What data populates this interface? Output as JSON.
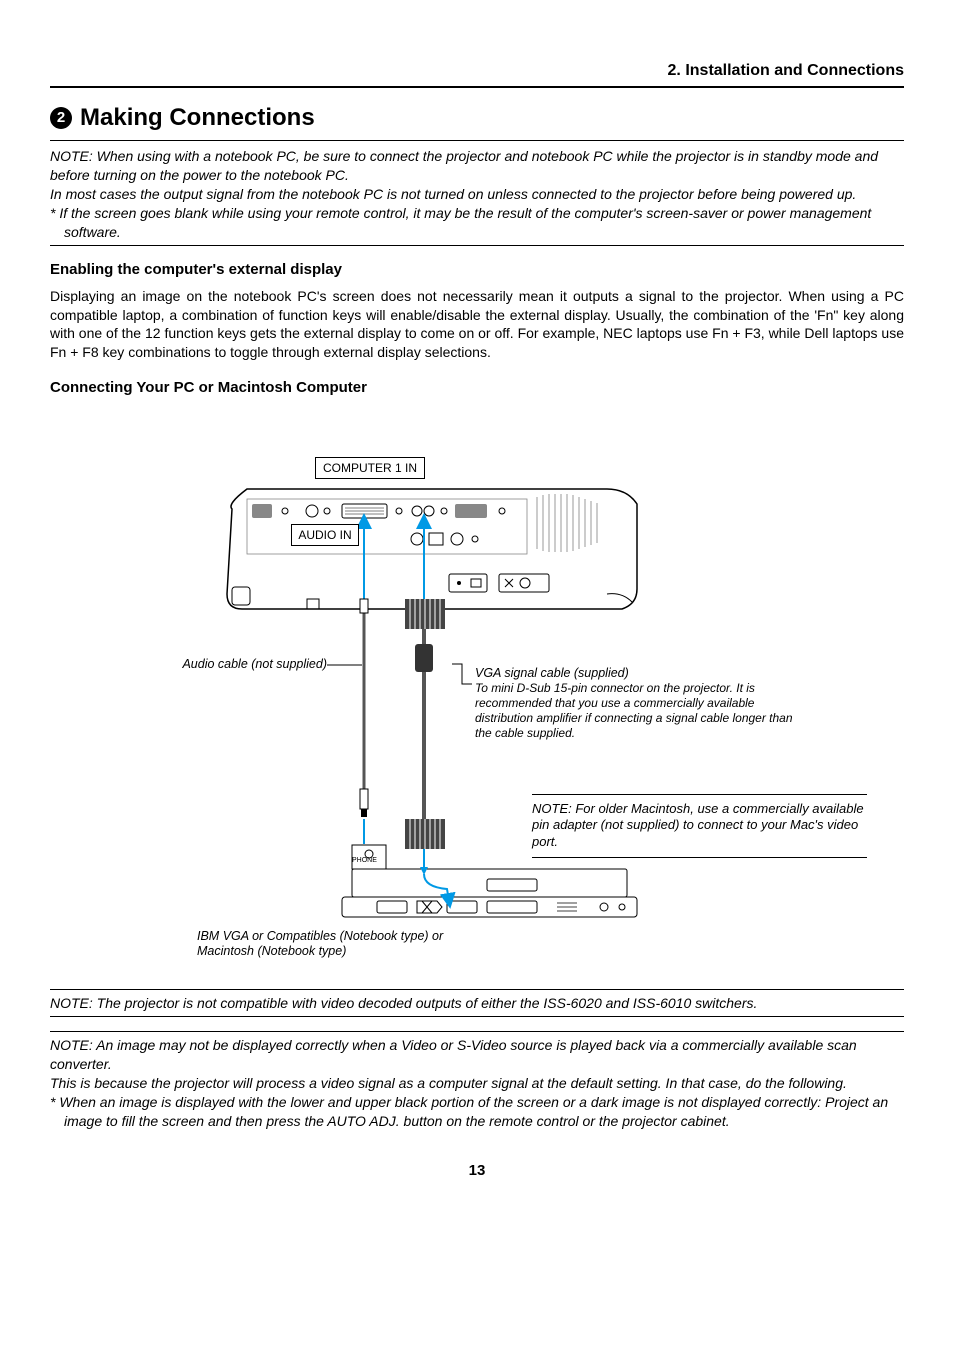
{
  "header": {
    "chapter": "2. Installation and Connections"
  },
  "section": {
    "number": "2",
    "title": "Making Connections"
  },
  "note1": {
    "p1": "NOTE: When using with a notebook PC, be sure to connect the projector and notebook PC while the projector is in standby mode and before turning on the power to the notebook PC.",
    "p2": "In most cases the output signal from the notebook PC is not turned on unless connected to the projector before being powered up.",
    "p3": "* If the screen goes blank while using your remote control, it may be the result of the computer's screen-saver or power management software."
  },
  "sub1": {
    "title": "Enabling the computer's external display",
    "body": "Displaying an image on the notebook PC's screen does not necessarily mean it outputs a signal to the projector. When using a PC compatible laptop, a combination of function keys will enable/disable the external display. Usually, the combination of the 'Fn\" key along with one of the 12 function keys gets the external display to come on or off. For example, NEC laptops use Fn + F3, while Dell laptops use Fn + F8 key combinations to toggle through external display selections."
  },
  "sub2": {
    "title": "Connecting Your PC or Macintosh Computer"
  },
  "diagram": {
    "label_computer1": "COMPUTER 1 IN",
    "label_audio": "AUDIO IN",
    "audio_cable": "Audio cable (not supplied)",
    "vga_title": "VGA signal cable (supplied)",
    "vga_desc": "To mini D-Sub 15-pin connector on the projector. It is recommended that you use a commercially available distribution amplifier if connecting a signal cable longer than the cable supplied.",
    "mac_note": "NOTE: For older Macintosh, use a commercially available pin adapter (not supplied) to connect to your Mac's video port.",
    "laptop_label": "IBM VGA or Compatibles (Notebook type) or Macintosh (Notebook type)",
    "phone_label": "PHONE"
  },
  "note2": "NOTE: The projector is not compatible with video decoded outputs of either the ISS-6020 and ISS-6010 switchers.",
  "note3": {
    "p1": "NOTE: An image may not be displayed correctly when a Video or S-Video source is played back via a commercially available scan converter.",
    "p2": "This is because the projector will process a video signal as a computer signal at the default setting. In that case, do the following.",
    "p3": "* When an image is displayed with the lower and upper black portion of the screen or a dark image is not displayed correctly: Project an image to fill the screen and then press the AUTO ADJ. button on the remote control or the projector cabinet."
  },
  "page": "13"
}
